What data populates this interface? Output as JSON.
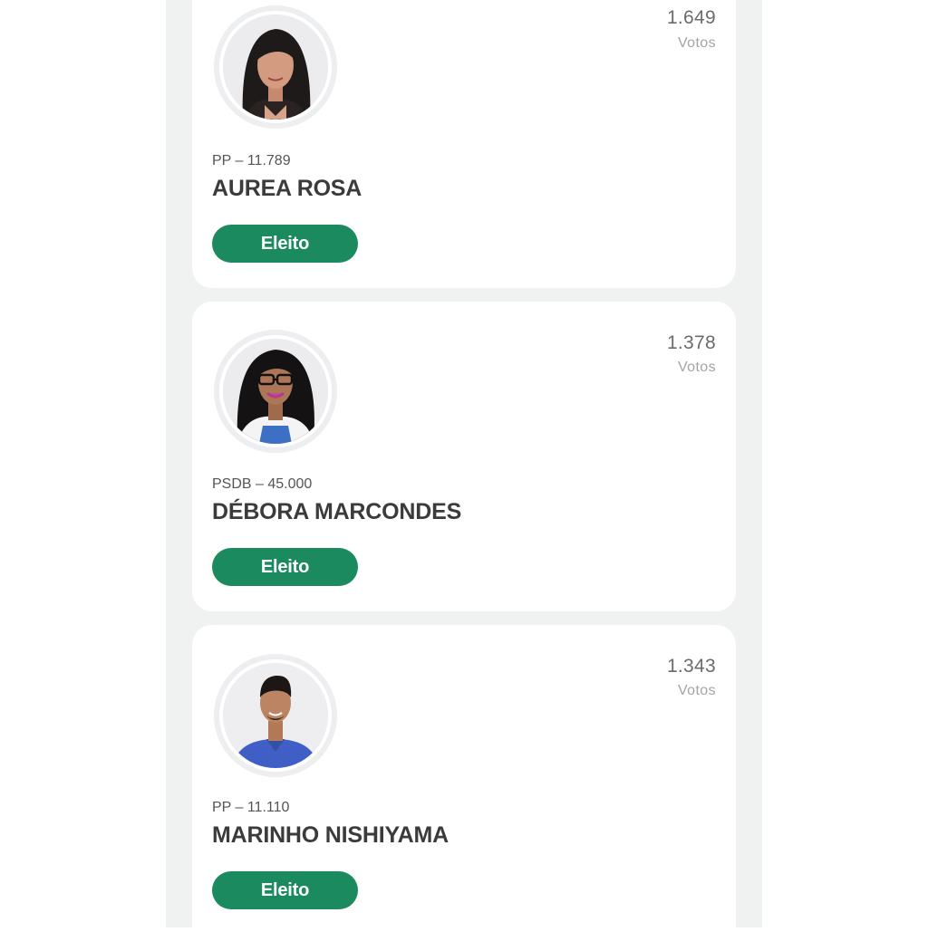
{
  "vote_label": "Votos",
  "candidates": [
    {
      "votes": "1.649",
      "party_number": "PP – 11.789",
      "name": "AUREA ROSA",
      "status": "Eleito",
      "photo": "woman-dark-hair-photo"
    },
    {
      "votes": "1.378",
      "party_number": "PSDB – 45.000",
      "name": "DÉBORA MARCONDES",
      "status": "Eleito",
      "photo": "woman-glasses-photo"
    },
    {
      "votes": "1.343",
      "party_number": "PP – 11.110",
      "name": "MARINHO NISHIYAMA",
      "status": "Eleito",
      "photo": "man-blue-shirt-photo"
    }
  ],
  "colors": {
    "status_green": "#1b8a5f",
    "page_background": "#f0f1f1",
    "card_background": "#ffffff"
  }
}
